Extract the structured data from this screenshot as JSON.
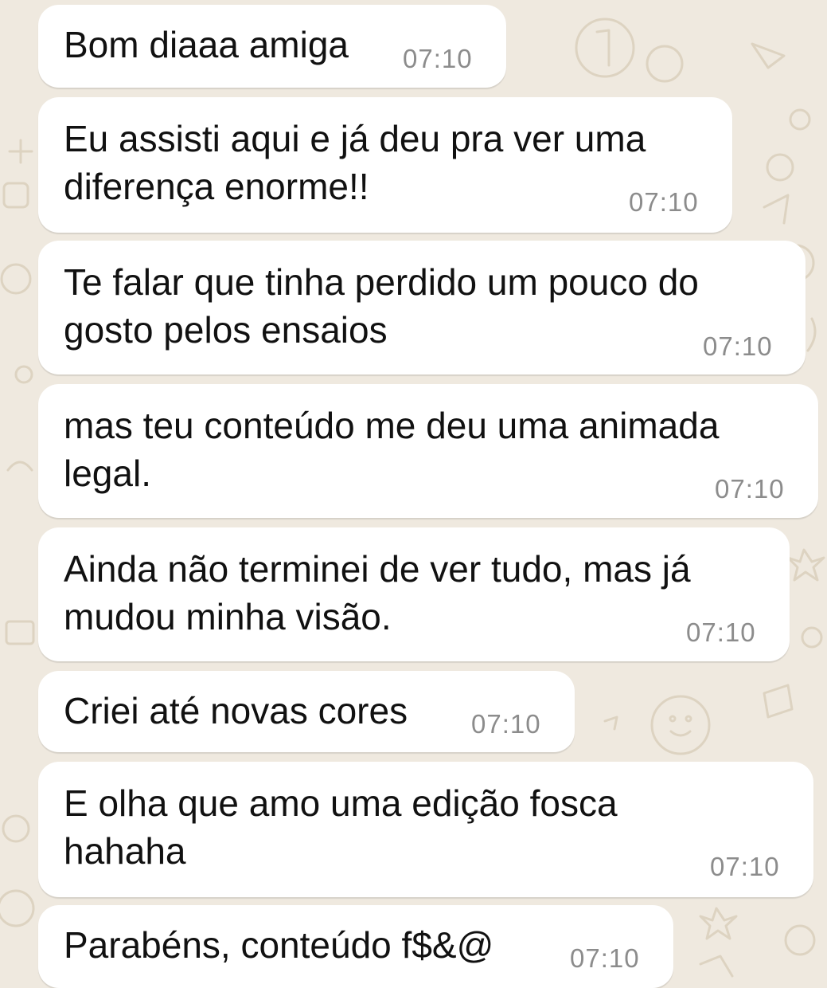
{
  "chat": {
    "messages": [
      {
        "lines": [
          "Bom diaaa amiga"
        ],
        "time": "07:10"
      },
      {
        "lines": [
          "Eu assisti aqui e já deu pra ver uma",
          "diferença enorme!!"
        ],
        "time": "07:10"
      },
      {
        "lines": [
          "Te falar que tinha perdido um pouco do",
          "gosto pelos ensaios"
        ],
        "time": "07:10"
      },
      {
        "lines": [
          "mas teu conteúdo me deu uma animada",
          "legal."
        ],
        "time": "07:10"
      },
      {
        "lines": [
          "Ainda não terminei de ver tudo, mas já",
          "mudou minha visão."
        ],
        "time": "07:10"
      },
      {
        "lines": [
          "Criei até novas cores"
        ],
        "time": "07:10"
      },
      {
        "lines": [
          "E olha que amo uma edição fosca",
          "hahaha"
        ],
        "time": "07:10"
      },
      {
        "lines": [
          "Parabéns, conteúdo f$&@"
        ],
        "time": "07:10"
      }
    ]
  },
  "colors": {
    "wallpaper": "#efe9df",
    "wallpaper_doodle": "#ddd3c1",
    "bubble": "#ffffff",
    "text": "#111111",
    "timestamp": "#8c8c8c"
  }
}
